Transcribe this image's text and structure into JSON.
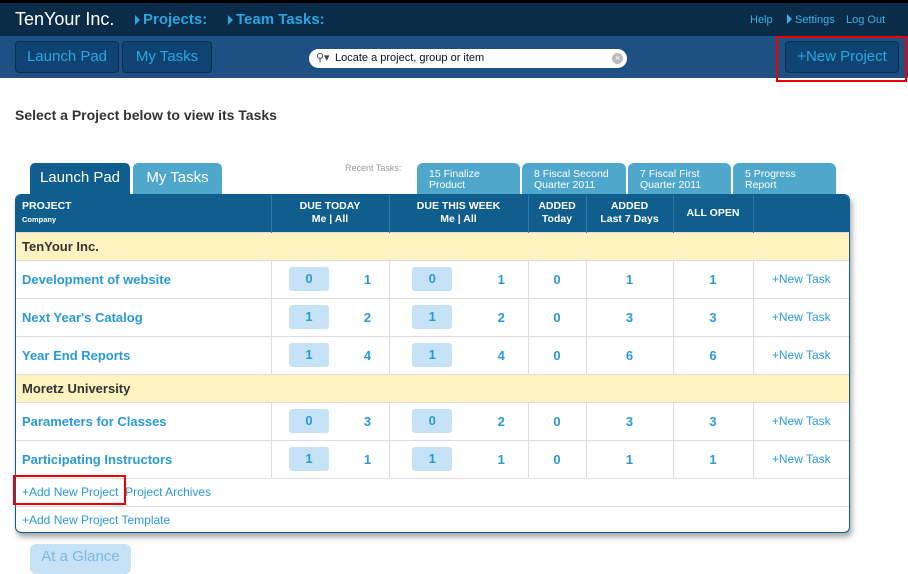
{
  "header": {
    "brand": "TenYour Inc.",
    "nav": [
      "Projects:",
      "Team Tasks:"
    ],
    "links": {
      "help": "Help",
      "settings": "Settings",
      "logout": "Log Out"
    }
  },
  "toolbar": {
    "launch_pad": "Launch Pad",
    "my_tasks": "My Tasks",
    "search_placeholder": "Locate a project, group or item",
    "new_project": "+New Project"
  },
  "page_title": "Select a Project below to view its Tasks",
  "tabs": [
    {
      "label": "Launch Pad",
      "active": true
    },
    {
      "label": "My Tasks",
      "active": false
    }
  ],
  "recent": {
    "label": "Recent Tasks:",
    "items": [
      [
        "15 Finalize",
        "Product"
      ],
      [
        "8 Fiscal Second",
        "Quarter 2011"
      ],
      [
        "7 Fiscal First",
        "Quarter 2011"
      ],
      [
        "5 Progress",
        "Report"
      ]
    ]
  },
  "table": {
    "headers": {
      "project": "PROJECT",
      "company": "Company",
      "due_today": "DUE TODAY",
      "due_week": "DUE THIS WEEK",
      "me_all": "Me | All",
      "added": "ADDED",
      "today": "Today",
      "last7": "Last 7 Days",
      "all_open": "ALL OPEN"
    },
    "groups": [
      {
        "name": "TenYour Inc.",
        "rows": [
          {
            "name": "Development of website",
            "dt_me": "0",
            "dt_all": "1",
            "dw_me": "0",
            "dw_all": "1",
            "added_today": "0",
            "added_7": "1",
            "open": "1",
            "new_task": "+New Task"
          },
          {
            "name": "Next Year's Catalog",
            "dt_me": "1",
            "dt_all": "2",
            "dw_me": "1",
            "dw_all": "2",
            "added_today": "0",
            "added_7": "3",
            "open": "3",
            "new_task": "+New Task"
          },
          {
            "name": "Year End Reports",
            "dt_me": "1",
            "dt_all": "4",
            "dw_me": "1",
            "dw_all": "4",
            "added_today": "0",
            "added_7": "6",
            "open": "6",
            "new_task": "+New Task"
          }
        ]
      },
      {
        "name": "Moretz University",
        "rows": [
          {
            "name": "Parameters for Classes",
            "dt_me": "0",
            "dt_all": "3",
            "dw_me": "0",
            "dw_all": "2",
            "added_today": "0",
            "added_7": "3",
            "open": "3",
            "new_task": "+New Task"
          },
          {
            "name": "Participating Instructors",
            "dt_me": "1",
            "dt_all": "1",
            "dw_me": "1",
            "dw_all": "1",
            "added_today": "0",
            "added_7": "1",
            "open": "1",
            "new_task": "+New Task"
          }
        ]
      }
    ],
    "footer": {
      "add_project": "+Add New Project",
      "archives": "Project Archives",
      "add_template": "+Add New Project Template"
    }
  },
  "glance": "At a Glance",
  "colors": {
    "topbar": "#0b2c48",
    "subbar": "#1f5083",
    "accent": "#2a9ad6",
    "group_bg": "#fdf2c0",
    "highlight": "#e00000"
  }
}
